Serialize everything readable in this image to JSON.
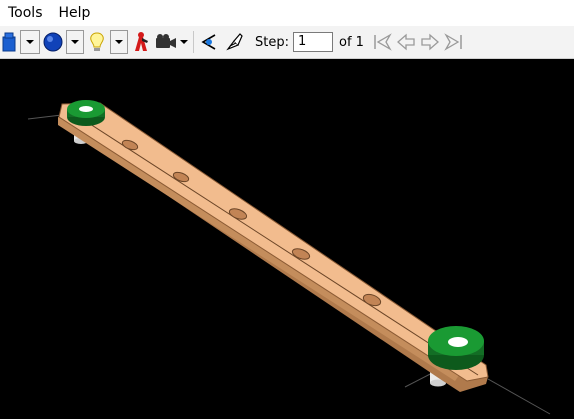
{
  "menubar": {
    "items": [
      {
        "label": "Tools"
      },
      {
        "label": "Help"
      }
    ]
  },
  "toolbar": {
    "icons": [
      "color-brick-icon",
      "dropdown-arrow-icon",
      "blue-circle-icon",
      "dropdown-arrow-icon",
      "light-bulb-icon",
      "dropdown-arrow-icon",
      "red-figure-icon",
      "camera-icon",
      "dropdown-arrow-icon",
      "view-angle-icon",
      "brush-icon"
    ],
    "step_label": "Step:",
    "step_value": "1",
    "of_label": "of 1",
    "nav_icons": [
      "first-step-icon",
      "previous-step-icon",
      "next-step-icon",
      "last-step-icon"
    ]
  },
  "viewport": {
    "background": "#000000",
    "plate_color": "#f0b88a",
    "ring_color": "#168a2e"
  }
}
